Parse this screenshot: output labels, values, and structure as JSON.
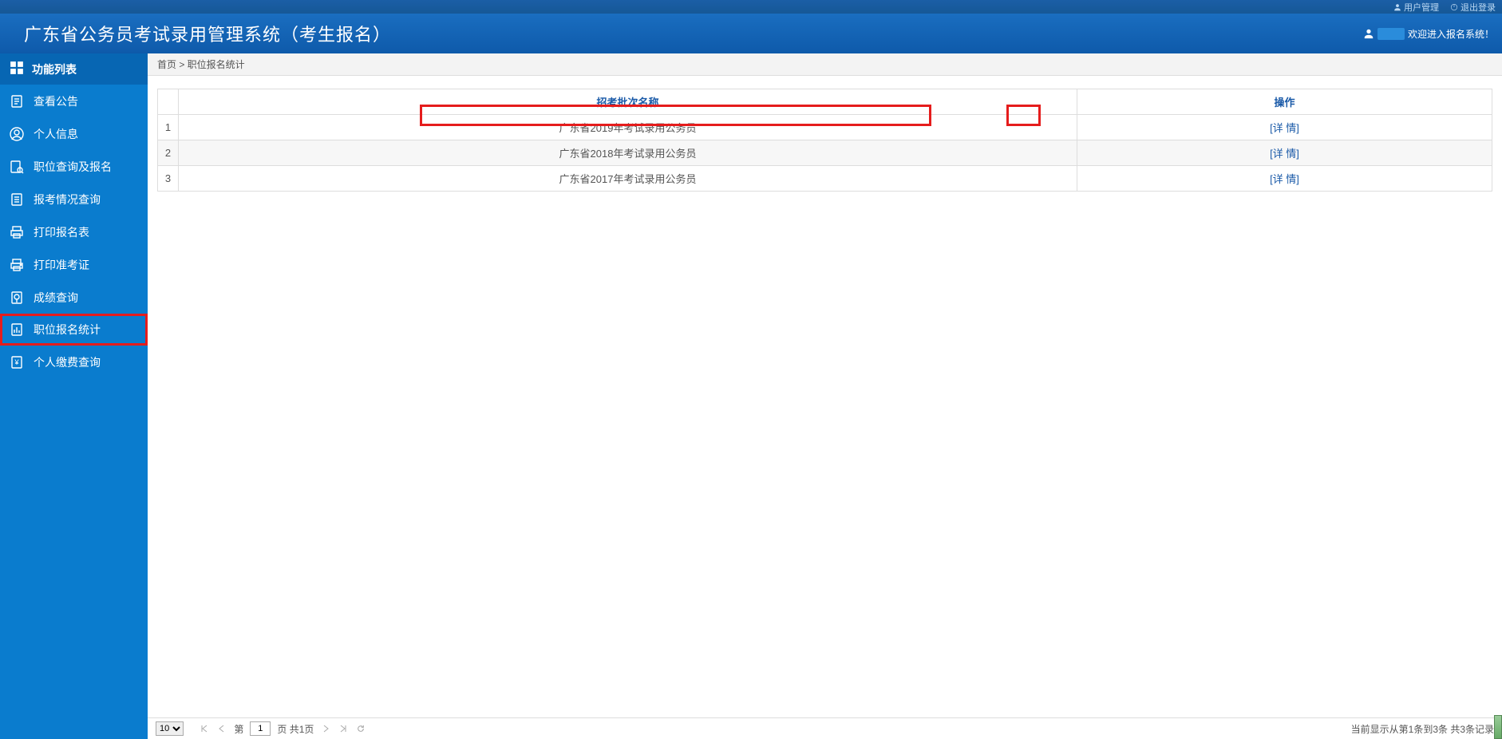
{
  "topbar": {
    "user_mgmt": "用户管理",
    "logout": "退出登录"
  },
  "header": {
    "title": "广东省公务员考试录用管理系统（考生报名）",
    "welcome": "欢迎进入报名系统！"
  },
  "sidebar": {
    "header": "功能列表",
    "items": [
      {
        "label": "查看公告",
        "icon": "doc"
      },
      {
        "label": "个人信息",
        "icon": "user"
      },
      {
        "label": "职位查询及报名",
        "icon": "search-doc"
      },
      {
        "label": "报考情况查询",
        "icon": "list"
      },
      {
        "label": "打印报名表",
        "icon": "print"
      },
      {
        "label": "打印准考证",
        "icon": "printer"
      },
      {
        "label": "成绩查询",
        "icon": "score"
      },
      {
        "label": "职位报名统计",
        "icon": "stats",
        "highlight": true
      },
      {
        "label": "个人缴费查询",
        "icon": "pay"
      }
    ]
  },
  "breadcrumb": {
    "text": "首页 > 职位报名统计"
  },
  "table": {
    "headers": {
      "idx": "",
      "name": "招考批次名称",
      "action": "操作"
    },
    "rows": [
      {
        "idx": "1",
        "name": "广东省2019年考试录用公务员",
        "action": "[详 情]",
        "highlight": true
      },
      {
        "idx": "2",
        "name": "广东省2018年考试录用公务员",
        "action": "[详 情]"
      },
      {
        "idx": "3",
        "name": "广东省2017年考试录用公务员",
        "action": "[详 情]"
      }
    ]
  },
  "footer": {
    "page_size": "10",
    "page_label_prefix": "第",
    "page_current": "1",
    "page_label_suffix": "页 共1页",
    "summary": "当前显示从第1条到3条 共3条记录"
  }
}
